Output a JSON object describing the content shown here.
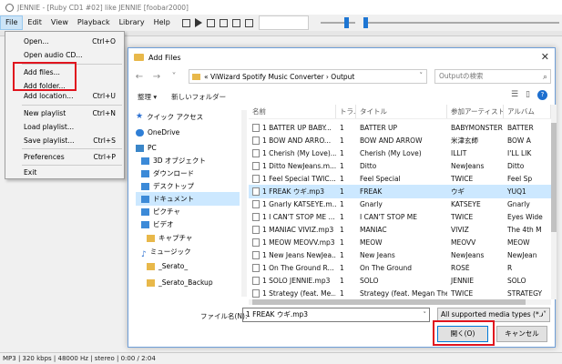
{
  "main_window": {
    "title": "JENNIE - [Ruby CD1 #02] like JENNIE  [foobar2000]",
    "menu": [
      "File",
      "Edit",
      "View",
      "Playback",
      "Library",
      "Help"
    ],
    "status": "MP3 | 320 kbps | 48000 Hz | stereo | 0:00 / 2:04"
  },
  "file_menu": {
    "items": [
      {
        "label": "Open...",
        "shortcut": "Ctrl+O"
      },
      {
        "label": "Open audio CD...",
        "shortcut": ""
      },
      {
        "label": "Add files...",
        "shortcut": ""
      },
      {
        "label": "Add folder...",
        "shortcut": ""
      },
      {
        "label": "Add location...",
        "shortcut": "Ctrl+U"
      },
      {
        "label": "New playlist",
        "shortcut": "Ctrl+N"
      },
      {
        "label": "Load playlist...",
        "shortcut": ""
      },
      {
        "label": "Save playlist...",
        "shortcut": "Ctrl+S"
      },
      {
        "label": "Preferences",
        "shortcut": "Ctrl+P"
      },
      {
        "label": "Exit",
        "shortcut": ""
      }
    ]
  },
  "dialog": {
    "title": "Add Files",
    "address": "« ViWizard Spotify Music Converter › Output",
    "search_placeholder": "Outputの検索",
    "organize": "整理 ▾",
    "new_folder": "新しいフォルダー",
    "nav": [
      {
        "label": "クイック アクセス",
        "icon": "star"
      },
      {
        "label": "OneDrive",
        "icon": "cloud"
      },
      {
        "label": "PC",
        "icon": "pc"
      },
      {
        "label": "3D オブジェクト",
        "icon": "blue"
      },
      {
        "label": "ダウンロード",
        "icon": "blue"
      },
      {
        "label": "デスクトップ",
        "icon": "blue"
      },
      {
        "label": "ドキュメント",
        "icon": "blue"
      },
      {
        "label": "ピクチャ",
        "icon": "blue"
      },
      {
        "label": "ビデオ",
        "icon": "blue"
      },
      {
        "label": "キャプチャ",
        "icon": "folder"
      },
      {
        "label": "ミュージック",
        "icon": "music"
      },
      {
        "label": "_Serato_",
        "icon": "folder"
      },
      {
        "label": "_Serato_Backup",
        "icon": "folder"
      }
    ],
    "columns": [
      "名前",
      "トラ...",
      "タイトル",
      "参加アーティスト",
      "アルバム"
    ],
    "files": [
      [
        "1 BATTER UP BABY...",
        "1",
        "BATTER UP",
        "BABYMONSTER",
        "BATTER"
      ],
      [
        "1 BOW AND ARRO...",
        "1",
        "BOW AND ARROW",
        "米津玄師",
        "BOW A"
      ],
      [
        "1 Cherish (My Love)...",
        "1",
        "Cherish (My Love)",
        "ILLIT",
        "I'LL LIK"
      ],
      [
        "1 Ditto NewJeans.m...",
        "1",
        "Ditto",
        "NewJeans",
        "Ditto"
      ],
      [
        "1 Feel Special TWIC...",
        "1",
        "Feel Special",
        "TWICE",
        "Feel Sp"
      ],
      [
        "1 FREAK ウギ.mp3",
        "1",
        "FREAK",
        "ウギ",
        "YUQ1"
      ],
      [
        "1 Gnarly KATSEYE.m...",
        "1",
        "Gnarly",
        "KATSEYE",
        "Gnarly"
      ],
      [
        "1 I CAN'T STOP ME ...",
        "1",
        "I CAN'T STOP ME",
        "TWICE",
        "Eyes Wide"
      ],
      [
        "1 MANIAC VIVIZ.mp3",
        "1",
        "MANIAC",
        "VIVIZ",
        "The 4th M"
      ],
      [
        "1 MEOW MEOVV.mp3",
        "1",
        "MEOW",
        "MEOVV",
        "MEOW"
      ],
      [
        "1 New Jeans NewJea...",
        "1",
        "New Jeans",
        "NewJeans",
        "NewJean"
      ],
      [
        "1 On The Ground R...",
        "1",
        "On The Ground",
        "ROSÉ",
        "R"
      ],
      [
        "1 SOLO JENNIE.mp3",
        "1",
        "SOLO",
        "JENNIE",
        "SOLO"
      ],
      [
        "1 Strategy (feat. Me...",
        "1",
        "Strategy (feat. Megan The...",
        "TWICE",
        "STRATEGY"
      ]
    ],
    "selected_index": 5,
    "filename_label": "ファイル名(N):",
    "filename_value": "1 FREAK ウギ.mp3",
    "filetype": "All supported media types (*.A",
    "open": "開く(O)",
    "cancel": "キャンセル"
  }
}
